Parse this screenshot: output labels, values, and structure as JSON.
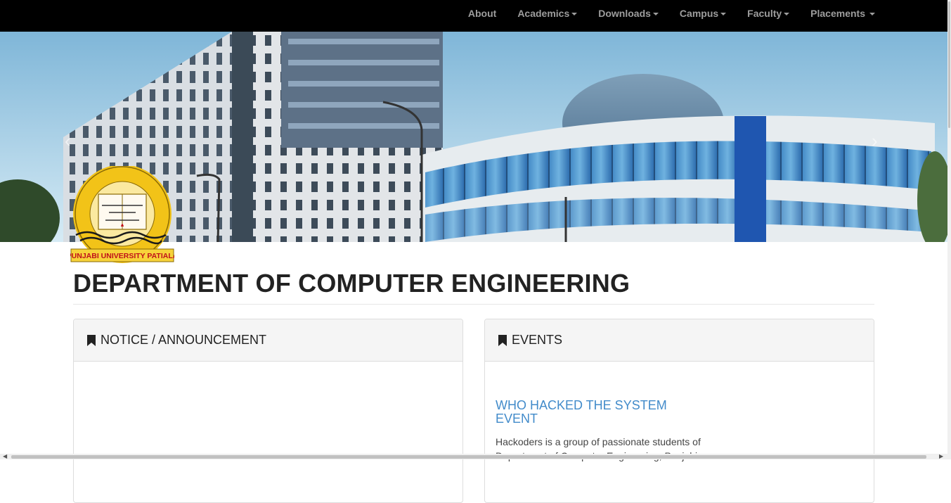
{
  "nav": {
    "items": [
      {
        "label": "About",
        "dropdown": false
      },
      {
        "label": "Academics",
        "dropdown": true
      },
      {
        "label": "Downloads",
        "dropdown": true
      },
      {
        "label": "Campus",
        "dropdown": true
      },
      {
        "label": "Faculty",
        "dropdown": true
      },
      {
        "label": "Placements",
        "dropdown": true
      }
    ]
  },
  "carousel": {
    "prev_glyph": "‹",
    "next_glyph": "›"
  },
  "logo": {
    "caption": "PUNJABI UNIVERSITY PATIALA",
    "colors": {
      "ring": "#f2c318",
      "caption_bg": "#f7d23a",
      "caption_text": "#c0101a"
    }
  },
  "page": {
    "title": "DEPARTMENT OF COMPUTER ENGINEERING"
  },
  "panels": {
    "notice": {
      "heading": "NOTICE / ANNOUNCEMENT",
      "icon": "bookmark-icon"
    },
    "events": {
      "heading": "EVENTS",
      "icon": "bookmark-icon",
      "items": [
        {
          "title": "WHO HACKED THE SYSTEM EVENT",
          "description": "Hackoders is a group of passionate students of Department of Computer Engineering, Punjabi"
        }
      ]
    }
  },
  "colors": {
    "navbar_bg": "#000000",
    "nav_text": "#9d9d9d",
    "link": "#428bca",
    "panel_heading_bg": "#f5f5f5"
  }
}
